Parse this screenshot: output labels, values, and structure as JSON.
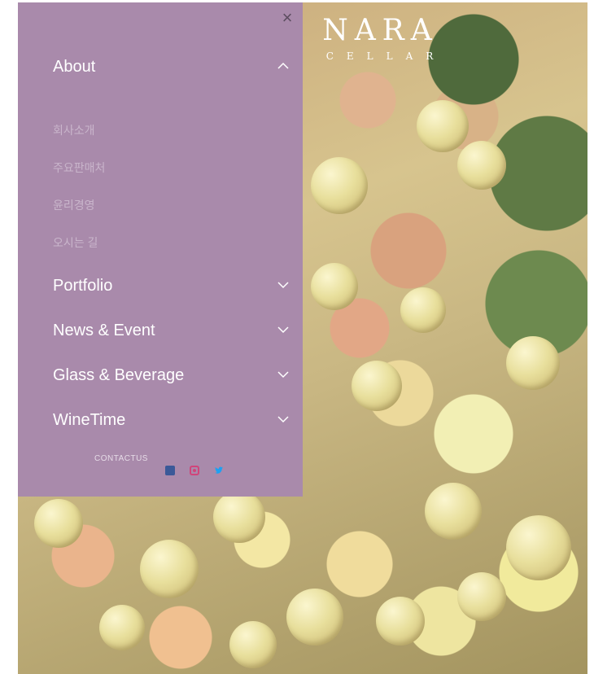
{
  "brand": {
    "name": "NARA",
    "sub": "CELLAR"
  },
  "menu": {
    "close_label": "×",
    "items": [
      {
        "label": "About",
        "expanded": true
      },
      {
        "label": "Portfolio",
        "expanded": false
      },
      {
        "label": "News & Event",
        "expanded": false
      },
      {
        "label": "Glass & Beverage",
        "expanded": false
      },
      {
        "label": "WineTime",
        "expanded": false
      }
    ],
    "about_subitems": [
      "회사소개",
      "주요판매처",
      "윤리경영",
      "오시는 길"
    ],
    "contact_label": "CONTACTUS",
    "social": [
      "facebook-icon",
      "instagram-icon",
      "twitter-icon"
    ]
  },
  "colors": {
    "panel": "#a98aab",
    "menu_text": "#ffffff",
    "subitem_text": "#c9b5cb",
    "close": "#5c4d60"
  }
}
